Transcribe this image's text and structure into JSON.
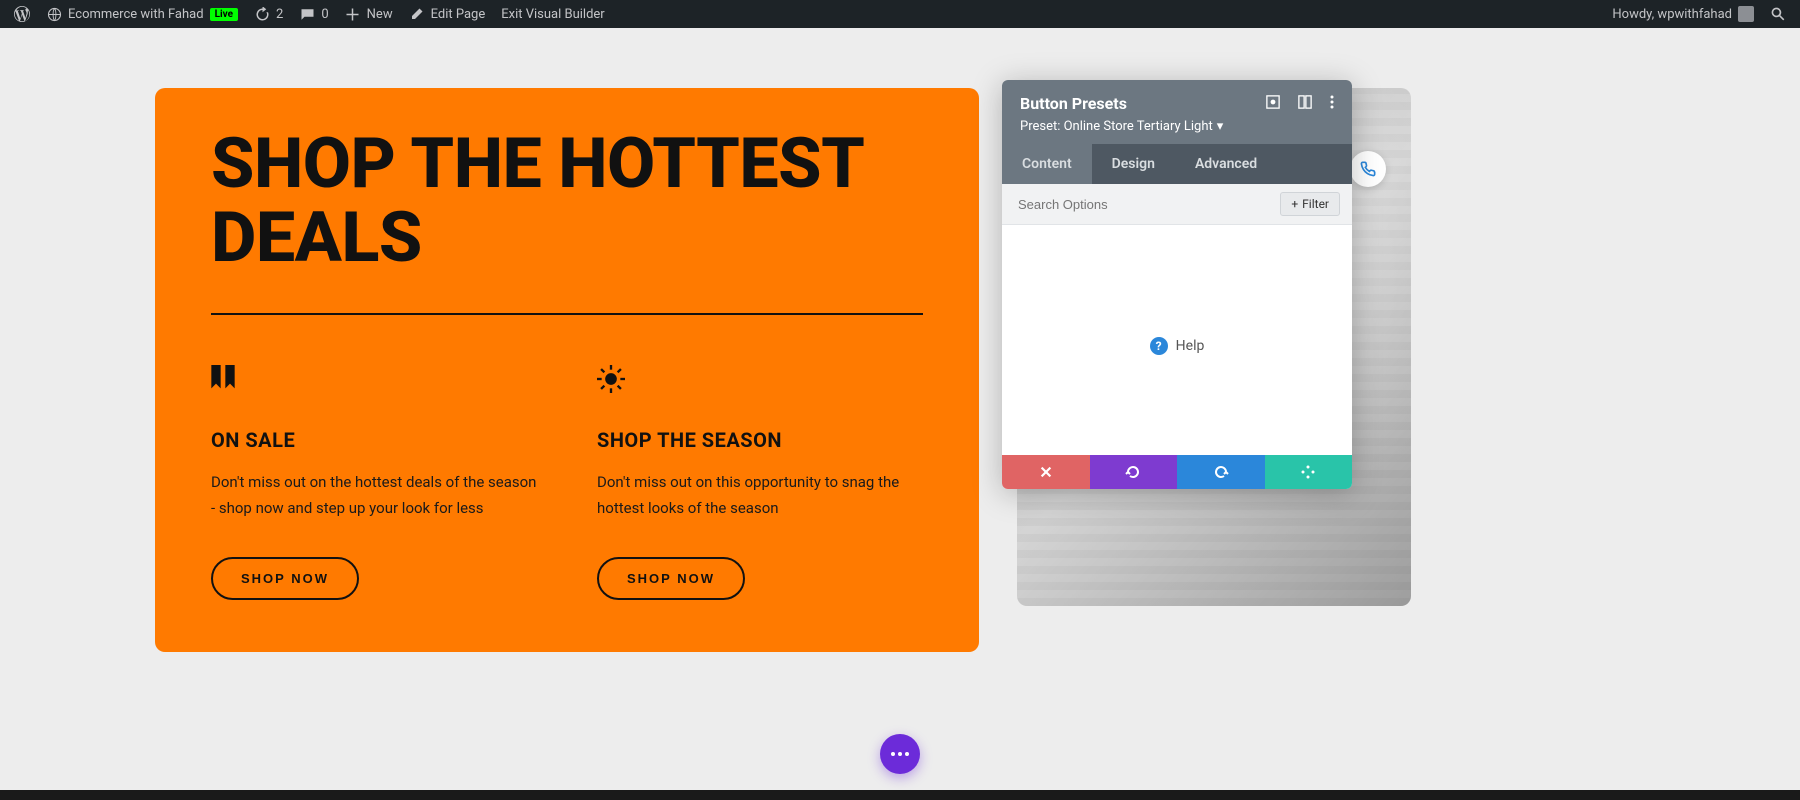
{
  "adminBar": {
    "siteName": "Ecommerce with Fahad",
    "liveBadge": "Live",
    "updates": "2",
    "comments": "0",
    "newLabel": "New",
    "editPage": "Edit Page",
    "exitBuilder": "Exit Visual Builder",
    "howdy": "Howdy, wpwithfahad"
  },
  "hero": {
    "title": "SHOP THE HOTTEST DEALS",
    "columns": [
      {
        "icon": "bookmark",
        "title": "ON SALE",
        "text": "Don't miss out on the hottest deals of the season - shop now and step up your look for less",
        "button": "SHOP NOW"
      },
      {
        "icon": "sun",
        "title": "SHOP THE SEASON",
        "text": "Don't miss out on this opportunity to snag the hottest looks of the season",
        "button": "SHOP NOW"
      }
    ]
  },
  "panel": {
    "title": "Button Presets",
    "preset": "Preset: Online Store Tertiary Light",
    "tabs": [
      "Content",
      "Design",
      "Advanced"
    ],
    "activeTab": 0,
    "searchPlaceholder": "Search Options",
    "filterLabel": "Filter",
    "helpLabel": "Help"
  }
}
